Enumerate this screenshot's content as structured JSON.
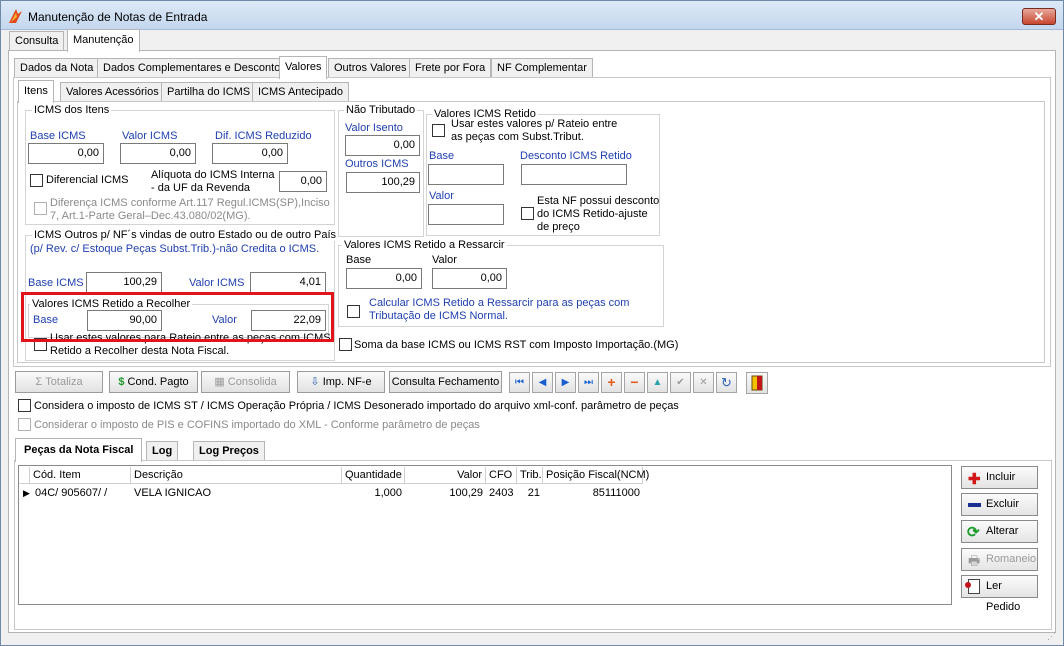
{
  "window": {
    "title": "Manutenção de Notas de Entrada",
    "close": "✕"
  },
  "top_tabs": [
    "Consulta",
    "Manutenção"
  ],
  "tabs2": [
    "Dados da Nota",
    "Dados Complementares e Desconto",
    "Valores",
    "Outros Valores",
    "Frete por Fora",
    "NF Complementar"
  ],
  "tabs3": [
    "Itens",
    "Valores Acessórios",
    "Partilha do ICMS",
    "ICMS Antecipado"
  ],
  "icms_itens": {
    "title": "ICMS dos Itens",
    "base_label": "Base ICMS",
    "base": "0,00",
    "valor_label": "Valor ICMS",
    "valor": "0,00",
    "dif_label": "Dif. ICMS Reduzido",
    "dif": "0,00",
    "diferencial_label": "Diferencial ICMS",
    "aliquota_label1": "Alíquota do ICMS Interna",
    "aliquota_label2": "- da UF da Revenda",
    "aliquota": "0,00",
    "diferenca_line1": "Diferença ICMS conforme Art.117 Regul.ICMS(SP),Inciso",
    "diferenca_line2": "7, Art.1-Parte Geral–Dec.43.080/02(MG)."
  },
  "icms_outros": {
    "line1": "ICMS Outros p/ NF´s vindas de outro Estado ou de outro País",
    "line2": "(p/ Rev. c/ Estoque Peças Subst.Trib.)-não Credita o ICMS.",
    "base_label": "Base ICMS",
    "base": "100,29",
    "valor_label": "Valor ICMS",
    "valor": "4,01"
  },
  "retido_recolher": {
    "title": "Valores ICMS Retido a Recolher",
    "base_label": "Base",
    "base": "90,00",
    "valor_label": "Valor",
    "valor": "22,09",
    "rateio_line1": "Usar estes valores para Rateio entre as peças com ICMS",
    "rateio_line2": "Retido a Recolher desta Nota Fiscal."
  },
  "nao_tributado": {
    "title": "Não Tributado",
    "isento_label": "Valor Isento",
    "isento": "0,00",
    "outros_label": "Outros ICMS",
    "outros": "100,29"
  },
  "retido": {
    "title": "Valores ICMS Retido",
    "rateio_line1": "Usar estes valores p/ Rateio  entre",
    "rateio_line2": "as peças com Subst.Tribut.",
    "base_label": "Base",
    "desconto_label": "Desconto ICMS Retido",
    "valor_label": "Valor",
    "nf_line1": "Esta NF possui desconto",
    "nf_line2": "do ICMS Retido-ajuste",
    "nf_line3": "de preço"
  },
  "ressarcir": {
    "title": "Valores ICMS Retido a Ressarcir",
    "base_label": "Base",
    "base": "0,00",
    "valor_label": "Valor",
    "valor": "0,00",
    "calc_line1": "Calcular ICMS Retido a  Ressarcir para as peças com",
    "calc_line2": "Tributação de ICMS Normal."
  },
  "soma_label": "Soma da base ICMS ou ICMS RST com Imposto Importação.(MG)",
  "toolbar": {
    "totaliza": "Totaliza",
    "cond_pagto": "Cond. Pagto",
    "consolida": "Consolida",
    "imp_nfe": "Imp.  NF-e",
    "consulta_fechamento": "Consulta Fechamento"
  },
  "options": {
    "considera_icms": "Considera o imposto de ICMS ST / ICMS Operação Própria / ICMS Desonerado importado do arquivo xml-conf. parâmetro de peças",
    "considera_pis": "Considerar o imposto de PIS e COFINS importado do XML - Conforme parâmetro de peças"
  },
  "bottom_tabs": [
    "Peças da Nota Fiscal",
    "Log",
    "Log Preços"
  ],
  "grid": {
    "columns": [
      "Cód. Item",
      "Descrição",
      "Quantidade",
      "Valor",
      "CFO",
      "Trib.",
      "Posição Fiscal(NCM)"
    ],
    "rows": [
      [
        "04C/  905607/  /",
        "VELA IGNICAO",
        "1,000",
        "100,29",
        "2403",
        "21",
        "85111000"
      ]
    ]
  },
  "side_buttons": {
    "incluir": "Incluir",
    "excluir": "Excluir",
    "alterar": "Alterar",
    "romaneio": "Romaneio",
    "ler_pedido": "Ler Pedido"
  },
  "colors": {
    "accent_red": "#e0141b",
    "label_blue": "#1f3fb0"
  }
}
